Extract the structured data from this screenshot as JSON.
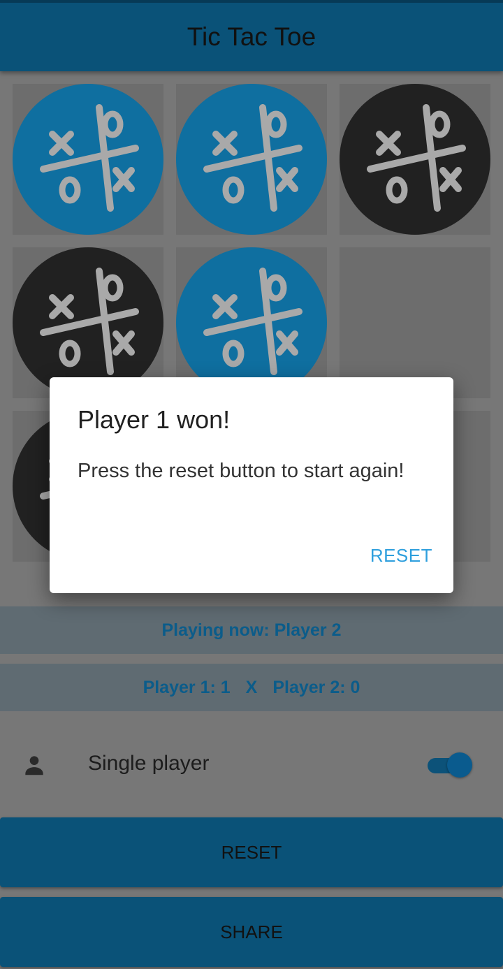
{
  "app": {
    "title": "Tic Tac Toe"
  },
  "colors": {
    "accent": "#0a5278",
    "blue_piece": "#0f6fa0",
    "dark_piece": "#212121",
    "dialog_button": "#2e9fdd"
  },
  "board": {
    "cells": [
      {
        "piece": "blue",
        "icon": "tic-tac-toe-logo-icon"
      },
      {
        "piece": "blue",
        "icon": "tic-tac-toe-logo-icon"
      },
      {
        "piece": "dark",
        "icon": "tic-tac-toe-logo-icon"
      },
      {
        "piece": "dark",
        "icon": "tic-tac-toe-logo-icon"
      },
      {
        "piece": "blue",
        "icon": "tic-tac-toe-logo-icon"
      },
      {
        "piece": "empty"
      },
      {
        "piece": "dark",
        "icon": "tic-tac-toe-logo-icon"
      },
      {
        "piece": "hidden"
      },
      {
        "piece": "empty"
      }
    ]
  },
  "status": {
    "playing_now": "Playing now: Player 2"
  },
  "score": {
    "player1": "Player 1: 1",
    "separator": "X",
    "player2": "Player 2: 0"
  },
  "mode": {
    "icon": "person-icon",
    "label": "Single player",
    "enabled": true
  },
  "buttons": {
    "reset": "RESET",
    "share": "SHARE"
  },
  "dialog": {
    "title": "Player 1 won!",
    "message": "Press the reset button to start again!",
    "button": "RESET"
  }
}
